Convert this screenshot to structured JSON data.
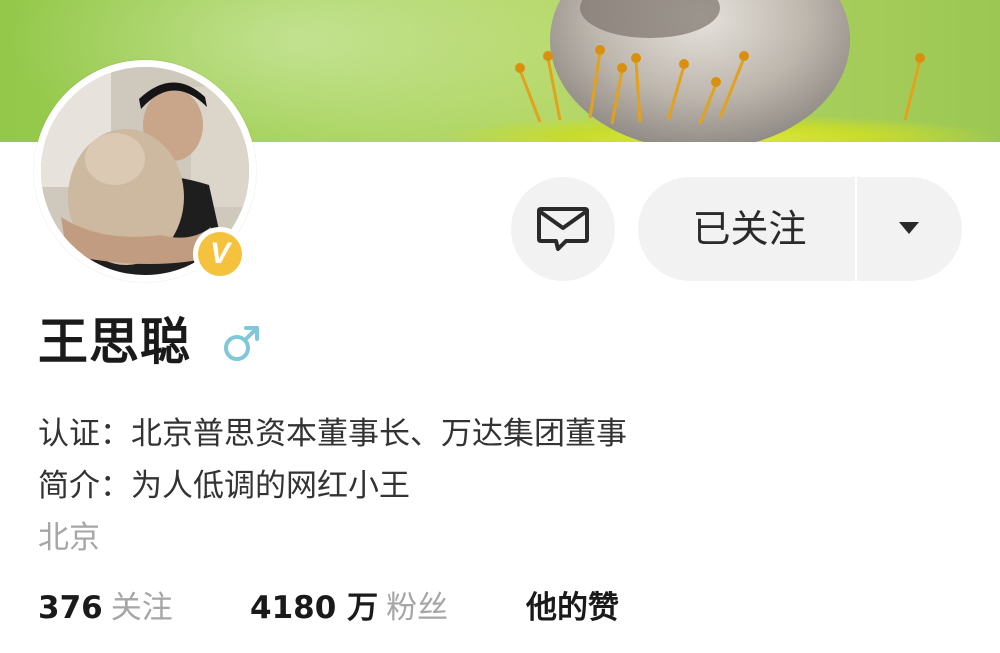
{
  "profile": {
    "name": "王思聪",
    "gender_icon": "male-symbol-icon",
    "verified_badge": "V",
    "certification_label": "认证：",
    "certification_text": "北京普思资本董事长、万达集团董事",
    "bio_label": "简介：",
    "bio_text": "为人低调的网红小王",
    "location": "北京"
  },
  "actions": {
    "message_icon": "envelope-icon",
    "follow_label": "已关注",
    "dropdown_icon": "caret-down-icon"
  },
  "stats": {
    "following_count": "376",
    "following_label": "关注",
    "followers_count": "4180 万",
    "followers_label": "粉丝",
    "likes_label": "他的赞"
  },
  "colors": {
    "badge": "#f5c23d",
    "gender": "#7fc7d9",
    "muted_text": "#a6a6a6",
    "button_bg": "#f2f2f2"
  }
}
